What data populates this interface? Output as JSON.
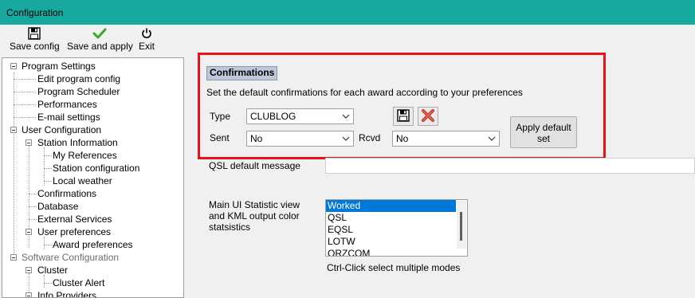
{
  "window": {
    "title": "Configuration"
  },
  "toolbar": {
    "save_config": "Save config",
    "save_apply": "Save and apply",
    "exit": "Exit"
  },
  "tree": {
    "program_settings": "Program Settings",
    "edit_program_config": "Edit program config",
    "program_scheduler": "Program Scheduler",
    "performances": "Performances",
    "email_settings": "E-mail settings",
    "user_configuration": "User Configuration",
    "station_information": "Station Information",
    "my_references": "My References",
    "station_configuration": "Station configuration",
    "local_weather": "Local weather",
    "confirmations": "Confirmations",
    "database": "Database",
    "external_services": "External Services",
    "user_preferences": "User preferences",
    "award_preferences": "Award preferences",
    "software_configuration": "Software Configuration",
    "cluster": "Cluster",
    "cluster_alert": "Cluster Alert",
    "info_providers": "Info Providers"
  },
  "confirmations": {
    "header": "Confirmations",
    "description": "Set the default confirmations for each award according to your preferences",
    "type_label": "Type",
    "type_value": "CLUBLOG",
    "sent_label": "Sent",
    "sent_value": "No",
    "rcvd_label": "Rcvd",
    "rcvd_value": "No",
    "apply_default_set": "Apply default set",
    "apply_line1": "Apply default",
    "apply_line2": "set"
  },
  "qsl": {
    "label": "QSL default message",
    "value": ""
  },
  "statistics": {
    "label_line1": "Main UI Statistic view",
    "label_line2": "and KML output color",
    "label_line3": "statsistics",
    "items": [
      "Worked",
      "QSL",
      "EQSL",
      "LOTW",
      "QRZCOM"
    ],
    "selected": "Worked",
    "hint": "Ctrl-Click select multiple modes"
  },
  "colors": {
    "titlebar": "#17a9a0",
    "highlight": "#e3121b",
    "selection": "#0078d7"
  }
}
